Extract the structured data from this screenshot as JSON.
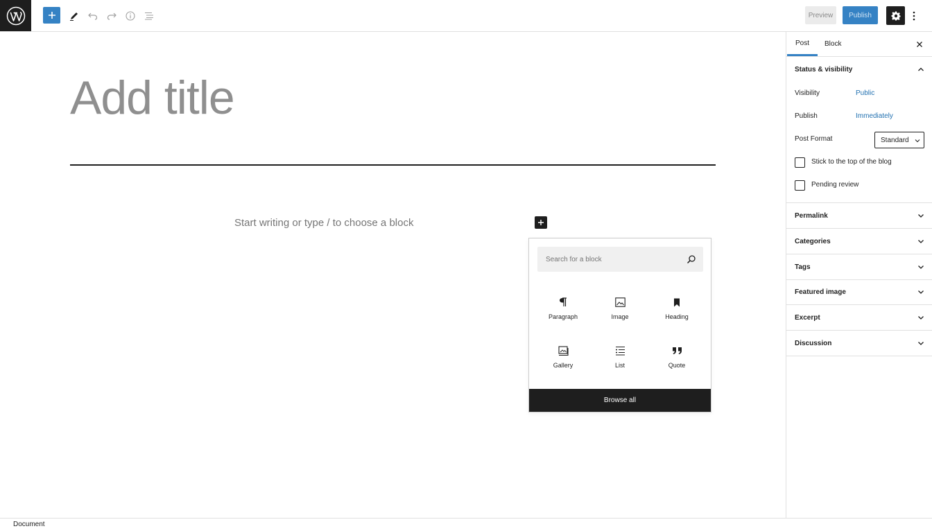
{
  "toolbar": {
    "preview_label": "Preview",
    "publish_label": "Publish"
  },
  "editor": {
    "title_placeholder": "Add title",
    "body_placeholder": "Start writing or type / to choose a block"
  },
  "inserter": {
    "search_placeholder": "Search for a block",
    "blocks": [
      {
        "label": "Paragraph",
        "icon": "paragraph-icon"
      },
      {
        "label": "Image",
        "icon": "image-icon"
      },
      {
        "label": "Heading",
        "icon": "heading-icon"
      },
      {
        "label": "Gallery",
        "icon": "gallery-icon"
      },
      {
        "label": "List",
        "icon": "list-icon"
      },
      {
        "label": "Quote",
        "icon": "quote-icon"
      }
    ],
    "browse_all_label": "Browse all"
  },
  "sidebar": {
    "tabs": [
      {
        "label": "Post"
      },
      {
        "label": "Block"
      }
    ],
    "status_panel": {
      "title": "Status & visibility",
      "visibility_label": "Visibility",
      "visibility_value": "Public",
      "publish_label": "Publish",
      "publish_value": "Immediately",
      "format_label": "Post Format",
      "format_value": "Standard",
      "sticky_label": "Stick to the top of the blog",
      "pending_label": "Pending review"
    },
    "panels": [
      {
        "title": "Permalink"
      },
      {
        "title": "Categories"
      },
      {
        "title": "Tags"
      },
      {
        "title": "Featured image"
      },
      {
        "title": "Excerpt"
      },
      {
        "title": "Discussion"
      }
    ]
  },
  "footer": {
    "breadcrumb": "Document"
  },
  "colors": {
    "accent": "#3582c4",
    "dark": "#1e1e1e",
    "link": "#2271b1"
  }
}
